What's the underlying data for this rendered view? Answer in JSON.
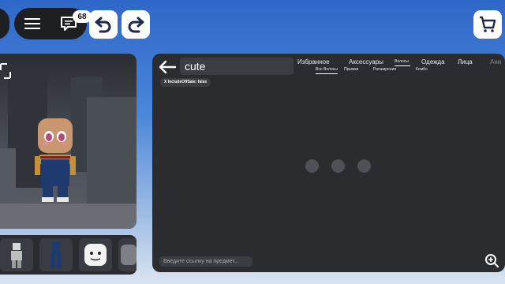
{
  "toolbar": {
    "notification_count": "68",
    "icons": [
      "menu-icon",
      "chat-icon",
      "undo-icon",
      "redo-icon",
      "cart-icon"
    ]
  },
  "search": {
    "value": "cute"
  },
  "category_tabs": [
    {
      "label": "Избранное"
    },
    {
      "label": "Аксессуары"
    },
    {
      "label": "Волосы"
    },
    {
      "label": "Одежда"
    },
    {
      "label": "Лица"
    },
    {
      "label": "Ани"
    }
  ],
  "sub_tabs": [
    {
      "label": "Все Волосы"
    },
    {
      "label": "Прыжки"
    },
    {
      "label": "Расширения"
    },
    {
      "label": "Комбо"
    }
  ],
  "filter_chip": {
    "label": "X IncludeOffSale: false"
  },
  "link_input": {
    "placeholder": "Введите ссылку на предмет..."
  },
  "colors": {
    "panel": "#2a2c30",
    "topbar_pill": "#1d1f22",
    "accent_white": "#ffffff"
  }
}
